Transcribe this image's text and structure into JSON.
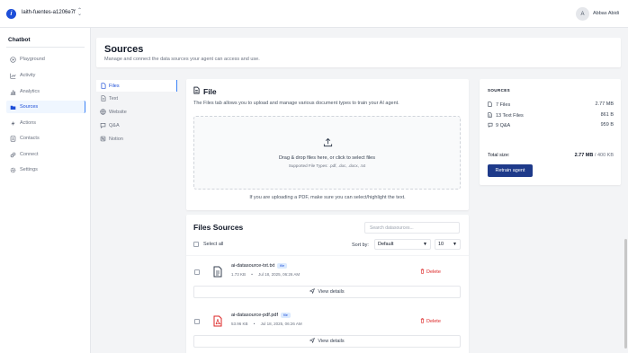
{
  "topbar": {
    "logo_letter": "i",
    "workspace": "laith-fuentes-a1206e7f",
    "avatar_letter": "A",
    "user_name": "Abbas Abidi"
  },
  "sidebar": {
    "title": "Chatbot",
    "items": [
      {
        "label": "Playground",
        "icon": "play-icon"
      },
      {
        "label": "Activity",
        "icon": "activity-icon"
      },
      {
        "label": "Analytics",
        "icon": "analytics-icon"
      },
      {
        "label": "Sources",
        "icon": "folder-icon",
        "active": true
      },
      {
        "label": "Actions",
        "icon": "bolt-icon"
      },
      {
        "label": "Contacts",
        "icon": "contacts-icon"
      },
      {
        "label": "Connect",
        "icon": "link-icon"
      },
      {
        "label": "Settings",
        "icon": "gear-icon"
      }
    ]
  },
  "header": {
    "title": "Sources",
    "subtitle": "Manage and connect the data sources your agent can access and use."
  },
  "subnav": {
    "items": [
      {
        "label": "Files",
        "icon": "file-icon",
        "active": true
      },
      {
        "label": "Text",
        "icon": "text-icon"
      },
      {
        "label": "Website",
        "icon": "globe-icon"
      },
      {
        "label": "Q&A",
        "icon": "chat-icon"
      },
      {
        "label": "Notion",
        "icon": "notion-icon"
      }
    ]
  },
  "file_panel": {
    "title": "File",
    "description": "The Files tab allows you to upload and manage various document types to train your AI agent.",
    "dropzone_text": "Drag & drop files here, or click to select files",
    "dropzone_sub": "Supported File Types: .pdf, .doc, .docx, .txt",
    "note": "If you are uploading a PDF, make sure you can select/highlight the text."
  },
  "files_sources": {
    "title": "Files Sources",
    "search_placeholder": "Search datasources...",
    "select_all": "Select all",
    "sort_label": "Sort by:",
    "sort_value": "Default",
    "per_page": "10",
    "rows": [
      {
        "name": "ai-datasource-txt.txt",
        "badge": "file",
        "size": "1.73 KB",
        "date": "Jul 18, 2025, 06:26 AM",
        "delete": "Delete",
        "view": "View details",
        "icon": "txt-file-icon"
      },
      {
        "name": "ai-datasource-pdf.pdf",
        "badge": "file",
        "size": "53.96 KB",
        "date": "Jul 18, 2025, 06:26 AM",
        "delete": "Delete",
        "view": "View details",
        "icon": "pdf-file-icon"
      }
    ]
  },
  "summary": {
    "heading": "SOURCES",
    "rows": [
      {
        "label": "7 Files",
        "value": "2.77 MB",
        "icon": "file-icon"
      },
      {
        "label": "13 Text Files",
        "value": "861 B",
        "icon": "text-icon"
      },
      {
        "label": "9 Q&A",
        "value": "959 B",
        "icon": "chat-icon"
      }
    ],
    "total_label": "Total size:",
    "total_value": "2.77 MB",
    "total_limit": "/ 400 KB",
    "retrain": "Retrain agent"
  },
  "colors": {
    "accent": "#1d4ed8",
    "button": "#1e3a8a",
    "danger": "#dc2626",
    "pdf": "#dc2626"
  }
}
